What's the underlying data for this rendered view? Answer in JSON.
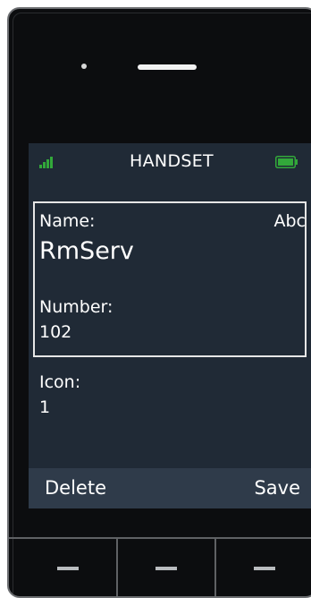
{
  "header": {
    "title": "HANDSET",
    "signal_icon": "signal-strength-icon",
    "battery_icon": "battery-full-icon",
    "accent_color": "#32a83a"
  },
  "fields": {
    "name_label": "Name:",
    "name_value": "RmServ",
    "input_mode": "Abc",
    "number_label": "Number:",
    "number_value": "102",
    "icon_label": "Icon:",
    "icon_value": "1"
  },
  "softkeys": {
    "left": "Delete",
    "right": "Save"
  },
  "keypad": {
    "keys": [
      "minus-icon",
      "minus-icon",
      "minus-icon"
    ]
  }
}
